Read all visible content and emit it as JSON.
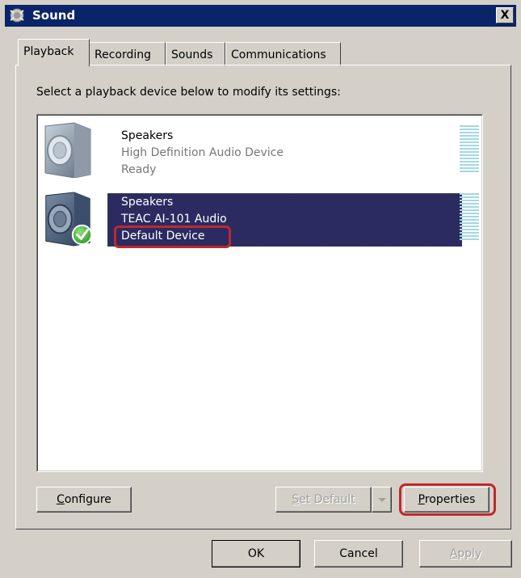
{
  "window": {
    "title": "Sound",
    "close_glyph": "X"
  },
  "tabs": [
    {
      "label": "Playback",
      "active": true
    },
    {
      "label": "Recording",
      "active": false
    },
    {
      "label": "Sounds",
      "active": false
    },
    {
      "label": "Communications",
      "active": false
    }
  ],
  "instruction": "Select a playback device below to modify its settings:",
  "devices": [
    {
      "name": "Speakers",
      "description": "High Definition Audio Device",
      "status": "Ready",
      "selected": false,
      "is_default": false,
      "icon": "speaker-icon"
    },
    {
      "name": "Speakers",
      "description": "TEAC AI-101 Audio",
      "status": "Default Device",
      "selected": true,
      "is_default": true,
      "icon": "speaker-default-icon"
    }
  ],
  "buttons": {
    "configure": {
      "pre": "",
      "accel": "C",
      "post": "onfigure"
    },
    "set_default": {
      "pre": "",
      "accel": "S",
      "post": "et Default",
      "enabled": false
    },
    "properties": {
      "pre": "",
      "accel": "P",
      "post": "roperties"
    },
    "ok": "OK",
    "cancel": "Cancel",
    "apply": {
      "pre": "",
      "accel": "A",
      "post": "pply",
      "enabled": false
    }
  },
  "colors": {
    "selection": "#2b2b61",
    "highlight_ring": "#c0282d",
    "meter": "#a3d8e6",
    "titlebar": "#0a246a"
  }
}
